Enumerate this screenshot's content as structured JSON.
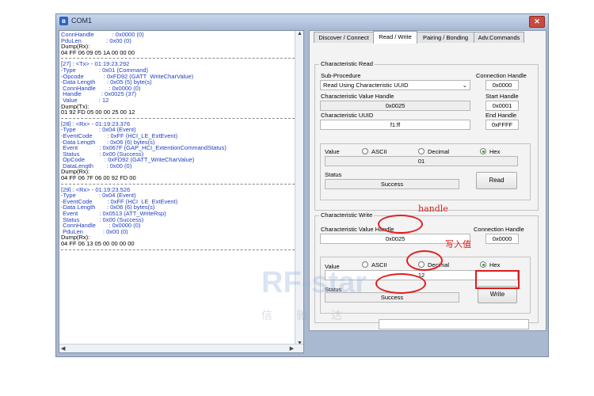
{
  "window": {
    "title": "COM1",
    "close_label": "✕"
  },
  "log": {
    "lines": [
      {
        "t": "ConnHandle           : 0x0000 (0)",
        "c": "blue"
      },
      {
        "t": "PduLen               : 0x00 (0)",
        "c": "blue"
      },
      {
        "t": "Dump(Rx):",
        "c": ""
      },
      {
        "t": "04 FF 06 09 05 1A 00 00 00",
        "c": ""
      },
      {
        "t": "",
        "c": "sep"
      },
      {
        "t": "[27] : <Tx> - 01:19:23.292",
        "c": "blue"
      },
      {
        "t": "-Type              : 0x01 (Command)",
        "c": "blue"
      },
      {
        "t": "-Opcode            : 0xFD92 (GATT_WriteCharValue)",
        "c": "blue"
      },
      {
        "t": "-Data Length       : 0x05 (5) byte(s)",
        "c": "blue"
      },
      {
        "t": " ConnHandle        : 0x0000 (0)",
        "c": "blue"
      },
      {
        "t": " Handle            : 0x0025 (37)",
        "c": "blue"
      },
      {
        "t": " Value             : 12",
        "c": "blue"
      },
      {
        "t": "Dump(Tx):",
        "c": ""
      },
      {
        "t": "01 92 FD 05 00 00 25 00 12",
        "c": ""
      },
      {
        "t": "",
        "c": "sep"
      },
      {
        "t": "[28] : <Rx> - 01:19:23.376",
        "c": "blue"
      },
      {
        "t": "-Type              : 0x04 (Event)",
        "c": "blue"
      },
      {
        "t": "-EventCode         : 0xFF (HCI_LE_ExtEvent)",
        "c": "blue"
      },
      {
        "t": "-Data Length       : 0x06 (6) bytes(s)",
        "c": "blue"
      },
      {
        "t": " Event             : 0x067F (GAP_HCI_ExtentionCommandStatus)",
        "c": "blue"
      },
      {
        "t": " Status            : 0x00 (Success)",
        "c": "blue"
      },
      {
        "t": " OpCode            : 0xFD92 (GATT_WriteCharValue)",
        "c": "blue"
      },
      {
        "t": " DataLength        : 0x00 (0)",
        "c": "blue"
      },
      {
        "t": "Dump(Rx):",
        "c": ""
      },
      {
        "t": "04 FF 06 7F 06 00 92 FD 00",
        "c": ""
      },
      {
        "t": "",
        "c": "sep"
      },
      {
        "t": "[29] : <Rx> - 01:19:23.526",
        "c": "blue"
      },
      {
        "t": "-Type              : 0x04 (Event)",
        "c": "blue"
      },
      {
        "t": "-EventCode         : 0xFF (HCI_LE_ExtEvent)",
        "c": "blue"
      },
      {
        "t": "-Data Length       : 0x06 (6) bytes(s)",
        "c": "blue"
      },
      {
        "t": " Event             : 0x0513 (ATT_WriteRsp)",
        "c": "blue"
      },
      {
        "t": " Status            : 0x00 (Success)",
        "c": "blue"
      },
      {
        "t": " ConnHandle        : 0x0000 (0)",
        "c": "blue"
      },
      {
        "t": " PduLen            : 0x00 (0)",
        "c": "blue"
      },
      {
        "t": "Dump(Rx):",
        "c": ""
      },
      {
        "t": "04 FF 06 13 05 00 00 00 00",
        "c": ""
      },
      {
        "t": "",
        "c": "sep"
      }
    ]
  },
  "tabs": [
    "Discover / Connect",
    "Read / Write",
    "Pairing / Bonding",
    "Adv.Commands"
  ],
  "read": {
    "group_title": "Characteristic Read",
    "sub_procedure_label": "Sub-Procedure",
    "sub_procedure_value": "Read Using Characteristic UUID",
    "conn_handle_label": "Connection Handle",
    "conn_handle_value": "0x0000",
    "start_handle_label": "Start Handle",
    "start_handle_value": "0x0001",
    "end_handle_label": "End Handle",
    "end_handle_value": "0xFFFF",
    "value_handle_label": "Characteristic Value Handle",
    "value_handle_value": "0x0025",
    "uuid_label": "Characteristic UUID",
    "uuid_value": "f1:ff",
    "value_label": "Value",
    "ascii": "ASCII",
    "decimal": "Decimal",
    "hex": "Hex",
    "value": "01",
    "status_label": "Status",
    "status_value": "Success",
    "button": "Read"
  },
  "write": {
    "group_title": "Characteristic Write",
    "value_handle_label": "Characteristic Value Handle",
    "value_handle_value": "0x0025",
    "conn_handle_label": "Connection Handle",
    "conn_handle_value": "0x0000",
    "value_label": "Value",
    "ascii": "ASCII",
    "decimal": "Decimal",
    "hex": "Hex",
    "value": "12",
    "status_label": "Status",
    "status_value": "Success",
    "button": "Write"
  },
  "annotations": {
    "handle": "handle",
    "write_value": "写入值"
  },
  "watermark": {
    "text": "RF-star",
    "cn": "信驰达"
  },
  "colors": {
    "highlight": "#e02020",
    "selected_radio": "#2b9b35"
  }
}
